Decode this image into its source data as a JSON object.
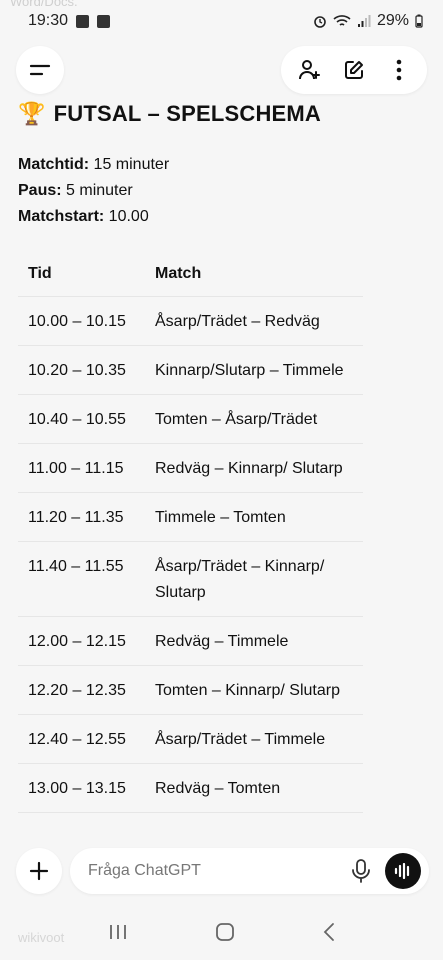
{
  "ghost_text": {
    "top": "Word/Docs.",
    "bottom": "wikivoot"
  },
  "status_bar": {
    "time": "19:30",
    "battery": "29%"
  },
  "top_nav": {
    "menu_icon": "menu-icon",
    "add_person_icon": "add-person-icon",
    "edit_icon": "edit-icon",
    "more_icon": "more-vertical-icon"
  },
  "page": {
    "emoji": "🏆",
    "title": "FUTSAL – SPELSCHEMA",
    "info": [
      {
        "label": "Matchtid:",
        "value": " 15 minuter"
      },
      {
        "label": "Paus:",
        "value": " 5 minuter"
      },
      {
        "label": "Matchstart:",
        "value": " 10.00"
      }
    ]
  },
  "schedule": {
    "headers": {
      "time": "Tid",
      "match": "Match"
    },
    "rows": [
      {
        "time": "10.00 – 10.15",
        "match": "Åsarp/Trädet – Redväg"
      },
      {
        "time": "10.20 – 10.35",
        "match": "Kinnarp/Slutarp – Timmele"
      },
      {
        "time": "10.40 – 10.55",
        "match": "Tomten – Åsarp/Trädet"
      },
      {
        "time": "11.00 – 11.15",
        "match": "Redväg – Kinnarp/ Slutarp"
      },
      {
        "time": "11.20 – 11.35",
        "match": "Timmele – Tomten"
      },
      {
        "time": "11.40 – 11.55",
        "match": "Åsarp/Trädet – Kinnarp/ Slutarp"
      },
      {
        "time": "12.00 – 12.15",
        "match": "Redväg – Timmele"
      },
      {
        "time": "12.20 – 12.35",
        "match": "Tomten – Kinnarp/ Slutarp"
      },
      {
        "time": "12.40 – 12.55",
        "match": "Åsarp/Trädet – Timmele"
      },
      {
        "time": "13.00 – 13.15",
        "match": "Redväg – Tomten"
      }
    ]
  },
  "composer": {
    "placeholder": "Fråga ChatGPT"
  }
}
